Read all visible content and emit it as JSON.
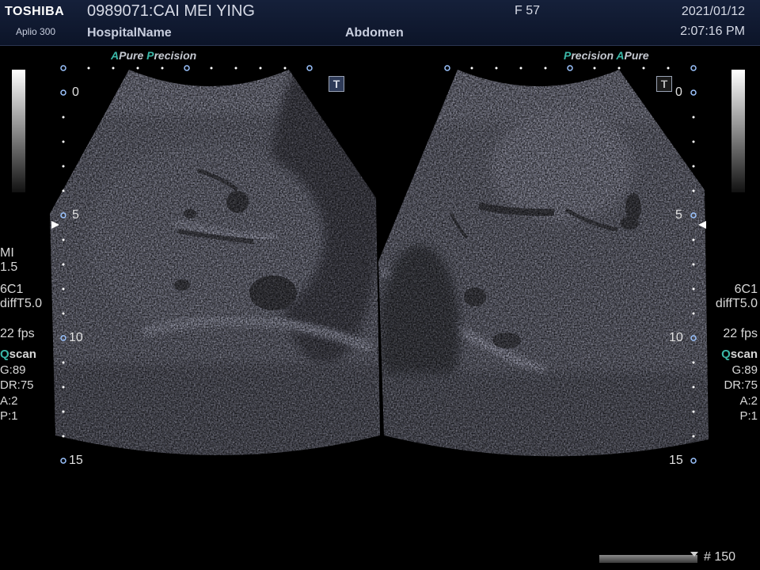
{
  "header": {
    "brand": "TOSHIBA",
    "model": "Aplio 300",
    "patient": "0989071:CAI MEI YING",
    "hospital": "HospitalName",
    "sex_age": "F  57",
    "exam": "Abdomen",
    "date": "2021/01/12",
    "time": "2:07:16 PM"
  },
  "branding": {
    "left": {
      "a1": "A",
      "w1": "Pure",
      "a2": "P",
      "w2": "recision"
    },
    "right": {
      "a1": "P",
      "w1": "recision",
      "a2": "A",
      "w2": "Pure"
    }
  },
  "left_panel": {
    "mi_label": "MI",
    "mi_value": "1.5",
    "probe": "6C1",
    "preset": "diffT5.0",
    "fps": "22 fps",
    "qscan_q": "Q",
    "qscan_rest": "scan",
    "gain": "G:89",
    "dr": "DR:75",
    "a": "A:2",
    "p": "P:1"
  },
  "right_panel": {
    "probe": "6C1",
    "preset": "diffT5.0",
    "fps": "22 fps",
    "qscan_q": "Q",
    "qscan_rest": "scan",
    "gain": "G:89",
    "dr": "DR:75",
    "a": "A:2",
    "p": "P:1"
  },
  "depth_scale": [
    "0",
    "5",
    "10",
    "15"
  ],
  "orientation_marker": "T",
  "footer": {
    "frame": "# 150"
  },
  "colors": {
    "accent": "#3bb8a8",
    "header_bg": "#0c1428"
  },
  "icons": [
    "orientation-marker-icon",
    "focus-arrow-icon",
    "depth-dot-icon"
  ]
}
